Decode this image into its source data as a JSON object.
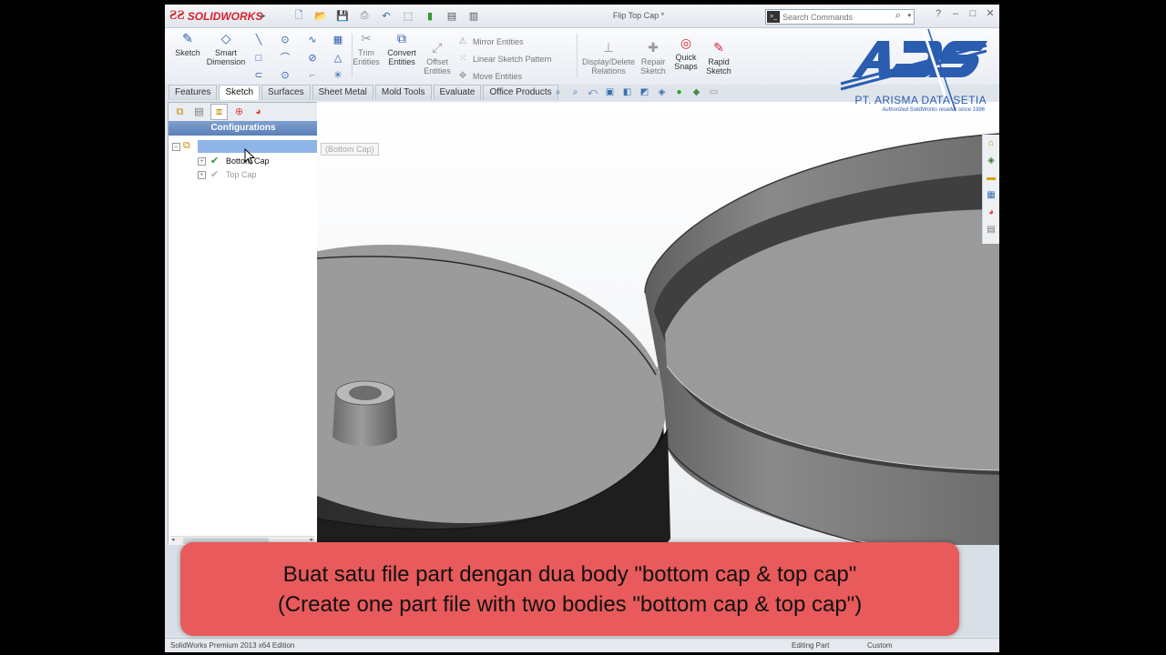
{
  "app": {
    "logo_text": "SOLIDWORKS",
    "document_title": "Flip Top Cap *",
    "edition": "SolidWorks Premium 2013 x64 Edition"
  },
  "search": {
    "placeholder": "Search Commands"
  },
  "commands": {
    "sketch": "Sketch",
    "smart_dimension": [
      "Smart",
      "Dimension"
    ],
    "trim_entities": [
      "Trim",
      "Entities"
    ],
    "convert_entities": [
      "Convert",
      "Entities"
    ],
    "offset_entities": [
      "Offset",
      "Entities"
    ],
    "mirror_entities": "Mirror Entities",
    "linear_sketch_pattern": "Linear Sketch Pattern",
    "move_entities": "Move Entities",
    "display_delete_relations": [
      "Display/Delete",
      "Relations"
    ],
    "repair_sketch": [
      "Repair",
      "Sketch"
    ],
    "quick_snaps": [
      "Quick",
      "Snaps"
    ],
    "rapid_sketch": [
      "Rapid",
      "Sketch"
    ]
  },
  "tabs": [
    "Features",
    "Sketch",
    "Surfaces",
    "Sheet Metal",
    "Mold Tools",
    "Evaluate",
    "Office Products"
  ],
  "active_tab": "Sketch",
  "panel": {
    "header": "Configurations",
    "tooltip": "(Bottom Cap)",
    "items": [
      {
        "label": "Bottom Cap",
        "active": true
      },
      {
        "label": "Top Cap",
        "active": false
      }
    ]
  },
  "watermark": {
    "company": "PT. ARISMA DATA SETIA",
    "tagline": "Authorized SolidWorks reseller since 1996"
  },
  "status": {
    "mode": "Editing Part",
    "units": "Custom"
  },
  "caption": {
    "line1": "Buat satu file part dengan dua body \"bottom cap & top cap\"",
    "line2": "(Create one part file with two bodies \"bottom cap &  top cap\")"
  },
  "colors": {
    "brand_red": "#d8202a",
    "selection": "#8fb4e6",
    "caption_bg": "#e85a5b",
    "watermark_blue": "#2a5db0",
    "check_green": "#2e9a2e"
  }
}
